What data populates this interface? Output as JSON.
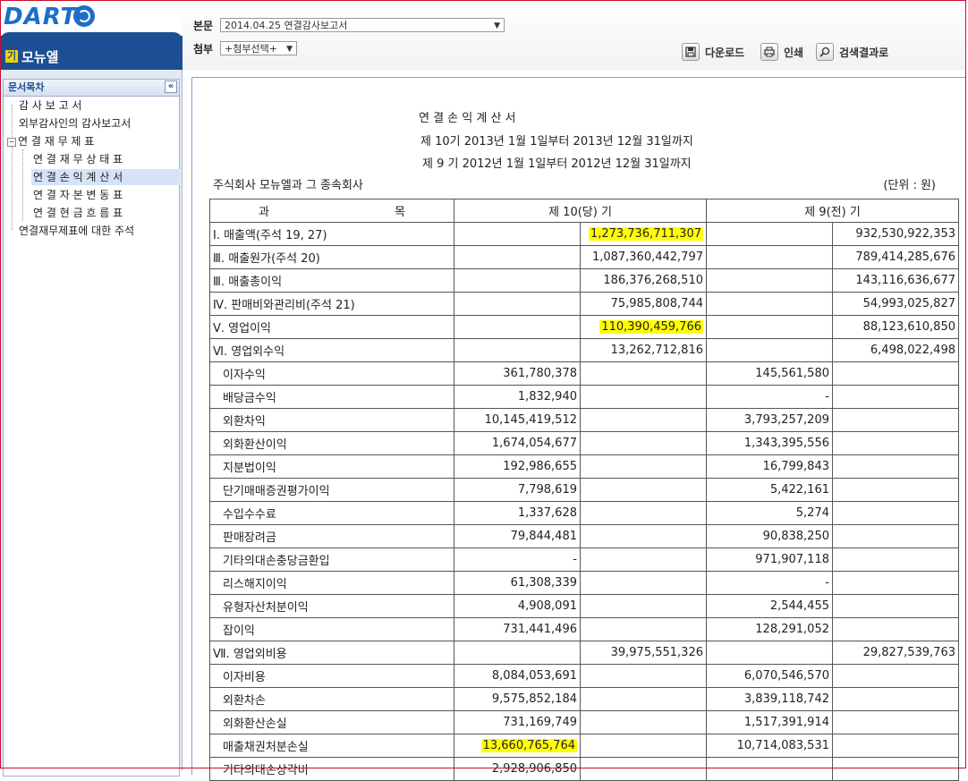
{
  "header": {
    "logo": "DART",
    "company_badge": "기",
    "company": "모뉴엘",
    "main_doc_label": "본문",
    "main_doc_value": "2014.04.25  연결감사보고서",
    "attach_label": "첨부",
    "attach_value": "+첨부선택+",
    "download": "다운로드",
    "print": "인쇄",
    "search_results": "검색결과로",
    "dropdown_icon": "▼"
  },
  "sidebar": {
    "title": "문서목차",
    "collapse_icon": "«",
    "items": [
      "감 사 보 고 서",
      "외부감사인의 감사보고서",
      "연 결 재 무 제 표",
      "연 결 재 무 상 태 표",
      "연 결 손 익 계 산 서",
      "연 결 자 본 변 동 표",
      "연 결 현 금 흐 름 표",
      "연결재무제표에 대한 주석"
    ],
    "selected_index": 4
  },
  "doc": {
    "title": "연 결 손 익 계 산 서",
    "period_current": "제 10기 2013년 1월 1일부터 2013년 12월 31일까지",
    "period_prior": "제 9 기 2012년 1월 1일부터 2012년 12월 31일까지",
    "company": "주식회사 모뉴엘과 그 종속회사",
    "unit": "(단위 : 원)",
    "col_item_a": "과",
    "col_item_b": "목",
    "col_current": "제 10(당) 기",
    "col_prior": "제 9(전) 기",
    "rows": [
      {
        "label": "Ⅰ. 매출액(주석 19, 27)",
        "c1": "",
        "c2": "1,273,736,711,307",
        "p1": "",
        "p2": "932,530,922,353",
        "hl": "c2"
      },
      {
        "label": "Ⅲ. 매출원가(주석 20)",
        "c1": "",
        "c2": "1,087,360,442,797",
        "p1": "",
        "p2": "789,414,285,676"
      },
      {
        "label": "Ⅲ. 매출총이익",
        "c1": "",
        "c2": "186,376,268,510",
        "p1": "",
        "p2": "143,116,636,677"
      },
      {
        "label": "Ⅳ. 판매비와관리비(주석 21)",
        "c1": "",
        "c2": "75,985,808,744",
        "p1": "",
        "p2": "54,993,025,827"
      },
      {
        "label": "Ⅴ. 영업이익",
        "c1": "",
        "c2": "110,390,459,766",
        "p1": "",
        "p2": "88,123,610,850",
        "hl": "c2"
      },
      {
        "label": "Ⅵ. 영업외수익",
        "c1": "",
        "c2": "13,262,712,816",
        "p1": "",
        "p2": "6,498,022,498"
      },
      {
        "label": "이자수익",
        "c1": "361,780,378",
        "c2": "",
        "p1": "145,561,580",
        "p2": "",
        "indent": true
      },
      {
        "label": "배당금수익",
        "c1": "1,832,940",
        "c2": "",
        "p1": "-",
        "p2": "",
        "indent": true
      },
      {
        "label": "외환차익",
        "c1": "10,145,419,512",
        "c2": "",
        "p1": "3,793,257,209",
        "p2": "",
        "indent": true
      },
      {
        "label": "외화환산이익",
        "c1": "1,674,054,677",
        "c2": "",
        "p1": "1,343,395,556",
        "p2": "",
        "indent": true
      },
      {
        "label": "지분법이익",
        "c1": "192,986,655",
        "c2": "",
        "p1": "16,799,843",
        "p2": "",
        "indent": true
      },
      {
        "label": "단기매매증권평가이익",
        "c1": "7,798,619",
        "c2": "",
        "p1": "5,422,161",
        "p2": "",
        "indent": true
      },
      {
        "label": "수입수수료",
        "c1": "1,337,628",
        "c2": "",
        "p1": "5,274",
        "p2": "",
        "indent": true
      },
      {
        "label": "판매장려금",
        "c1": "79,844,481",
        "c2": "",
        "p1": "90,838,250",
        "p2": "",
        "indent": true
      },
      {
        "label": "기타의대손충당금환입",
        "c1": "-",
        "c2": "",
        "p1": "971,907,118",
        "p2": "",
        "indent": true
      },
      {
        "label": "리스해지이익",
        "c1": "61,308,339",
        "c2": "",
        "p1": "-",
        "p2": "",
        "indent": true
      },
      {
        "label": "유형자산처분이익",
        "c1": "4,908,091",
        "c2": "",
        "p1": "2,544,455",
        "p2": "",
        "indent": true
      },
      {
        "label": "잡이익",
        "c1": "731,441,496",
        "c2": "",
        "p1": "128,291,052",
        "p2": "",
        "indent": true
      },
      {
        "label": "Ⅶ. 영업외비용",
        "c1": "",
        "c2": "39,975,551,326",
        "p1": "",
        "p2": "29,827,539,763"
      },
      {
        "label": "이자비용",
        "c1": "8,084,053,691",
        "c2": "",
        "p1": "6,070,546,570",
        "p2": "",
        "indent": true
      },
      {
        "label": "외환차손",
        "c1": "9,575,852,184",
        "c2": "",
        "p1": "3,839,118,742",
        "p2": "",
        "indent": true
      },
      {
        "label": "외화환산손실",
        "c1": "731,169,749",
        "c2": "",
        "p1": "1,517,391,914",
        "p2": "",
        "indent": true
      },
      {
        "label": "매출채권처분손실",
        "c1": "13,660,765,764",
        "c2": "",
        "p1": "10,714,083,531",
        "p2": "",
        "indent": true,
        "hl": "c1"
      },
      {
        "label": "기타의대손상각비",
        "c1": "2,928,906,850",
        "c2": "",
        "p1": "",
        "p2": "",
        "indent": true
      }
    ]
  },
  "colors": {
    "brand": "#1c4f93",
    "highlight": "#ffff00",
    "frame": "#c8102e"
  }
}
